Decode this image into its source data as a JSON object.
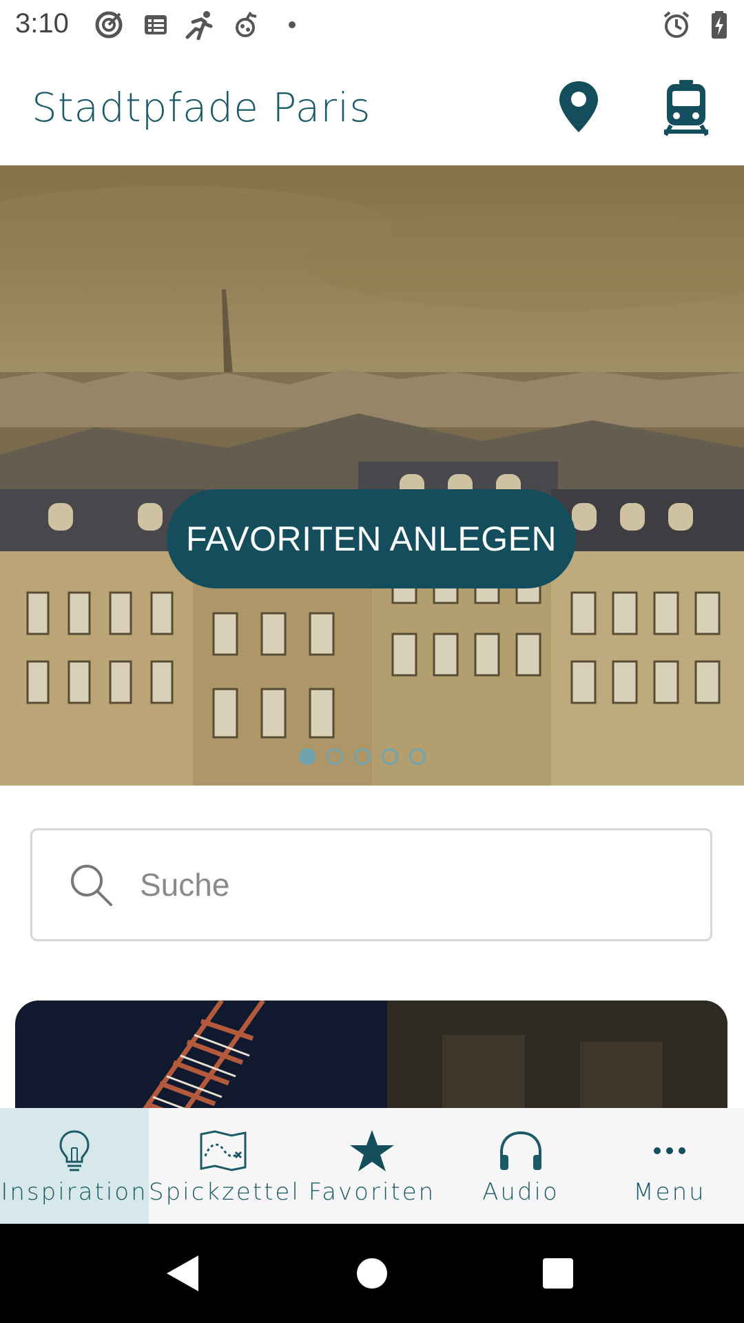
{
  "status_bar": {
    "time": "3:10",
    "left_icons": [
      "target-icon",
      "news-icon",
      "runner-icon",
      "fruit-icon",
      "dot-icon"
    ],
    "right_icons": [
      "alarm-icon",
      "battery-charging-icon"
    ]
  },
  "header": {
    "title": "Stadtpfade Paris",
    "actions": [
      "map-pin-icon",
      "train-icon"
    ],
    "accent_color": "#1b5a66"
  },
  "hero": {
    "cta_label": "FAVORITEN ANLEGEN",
    "cta_color": "#144e5c",
    "slide_count": 5,
    "active_slide": 1
  },
  "search": {
    "placeholder": "Suche",
    "value": ""
  },
  "bottom_nav": {
    "items": [
      {
        "label": "Inspiration",
        "icon": "lightbulb-icon",
        "active": true
      },
      {
        "label": "Spickzettel",
        "icon": "map-route-icon",
        "active": false
      },
      {
        "label": "Favoriten",
        "icon": "star-icon",
        "active": false
      },
      {
        "label": "Audio",
        "icon": "headphones-icon",
        "active": false
      },
      {
        "label": "Menu",
        "icon": "more-dots-icon",
        "active": false
      }
    ],
    "active_bg": "#d6e8ea"
  },
  "system_nav": {
    "buttons": [
      "back-icon",
      "home-icon",
      "recents-icon"
    ]
  }
}
